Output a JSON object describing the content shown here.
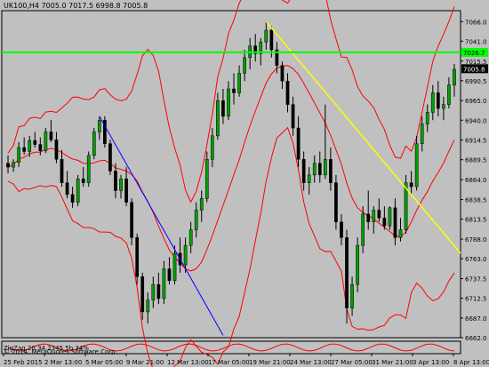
{
  "header": {
    "title": "UK100,H4  7005.0 7017.5 6998.8 7005.8"
  },
  "sub_window": {
    "label": "ZigZag 20 34.2345 5b 34%"
  },
  "copyright": "© 2014, MetaQuotes Software Corp.",
  "price_labels": {
    "horizontal_line": "7026.7",
    "current_price": "7005.8"
  },
  "colors": {
    "background": "#c0c0c0",
    "bull_candle": "#00a000",
    "bear_candle": "#000000",
    "bands": "#ff0000",
    "horizontal_line": "#00ff00",
    "trend_line_yellow": "#ffff00",
    "trend_line_blue": "#0000ff",
    "current_price_bg": "#000000",
    "horizontal_label_bg": "#00ff00"
  },
  "chart_data": {
    "type": "candlestick",
    "symbol": "UK100",
    "timeframe": "H4",
    "ylim": [
      6662,
      7080
    ],
    "y_ticks": [
      "7066.0",
      "7041.0",
      "7015.5",
      "6990.5",
      "6965.0",
      "6940.0",
      "6914.5",
      "6889.5",
      "6864.0",
      "6838.5",
      "6813.5",
      "6788.0",
      "6763.0",
      "6737.5",
      "6712.5",
      "6687.0",
      "6662.0"
    ],
    "x_ticks": [
      "25 Feb 2015",
      "2 Mar 13:00",
      "5 Mar 05:00",
      "9 Mar 21:00",
      "12 Mar 13:00",
      "17 Mar 05:00",
      "19 Mar 21:00",
      "24 Mar 13:00",
      "27 Mar 05:00",
      "31 Mar 21:00",
      "3 Apr 13:00",
      "8 Apr 13:00"
    ],
    "horizontal_line_price": 7026.7,
    "current_price": 7005.8,
    "candles": [
      [
        6885,
        6895,
        6872,
        6880
      ],
      [
        6880,
        6890,
        6874,
        6886
      ],
      [
        6886,
        6912,
        6880,
        6905
      ],
      [
        6905,
        6918,
        6896,
        6900
      ],
      [
        6900,
        6920,
        6893,
        6914
      ],
      [
        6914,
        6925,
        6905,
        6909
      ],
      [
        6909,
        6918,
        6895,
        6901
      ],
      [
        6901,
        6930,
        6898,
        6925
      ],
      [
        6925,
        6940,
        6912,
        6915
      ],
      [
        6915,
        6925,
        6885,
        6890
      ],
      [
        6890,
        6902,
        6855,
        6860
      ],
      [
        6860,
        6875,
        6840,
        6845
      ],
      [
        6845,
        6855,
        6828,
        6835
      ],
      [
        6835,
        6870,
        6830,
        6865
      ],
      [
        6865,
        6880,
        6855,
        6860
      ],
      [
        6860,
        6900,
        6855,
        6895
      ],
      [
        6895,
        6930,
        6890,
        6925
      ],
      [
        6925,
        6945,
        6915,
        6940
      ],
      [
        6940,
        6945,
        6905,
        6910
      ],
      [
        6910,
        6915,
        6870,
        6875
      ],
      [
        6875,
        6885,
        6840,
        6850
      ],
      [
        6850,
        6870,
        6840,
        6865
      ],
      [
        6865,
        6880,
        6830,
        6835
      ],
      [
        6835,
        6840,
        6780,
        6790
      ],
      [
        6790,
        6795,
        6730,
        6740
      ],
      [
        6740,
        6745,
        6685,
        6695
      ],
      [
        6695,
        6720,
        6680,
        6710
      ],
      [
        6710,
        6740,
        6700,
        6730
      ],
      [
        6730,
        6745,
        6705,
        6712
      ],
      [
        6712,
        6760,
        6705,
        6750
      ],
      [
        6750,
        6765,
        6730,
        6735
      ],
      [
        6735,
        6780,
        6730,
        6770
      ],
      [
        6770,
        6790,
        6745,
        6755
      ],
      [
        6755,
        6790,
        6745,
        6780
      ],
      [
        6780,
        6810,
        6770,
        6800
      ],
      [
        6800,
        6835,
        6790,
        6825
      ],
      [
        6825,
        6850,
        6810,
        6840
      ],
      [
        6840,
        6900,
        6835,
        6890
      ],
      [
        6890,
        6930,
        6880,
        6920
      ],
      [
        6920,
        6975,
        6915,
        6965
      ],
      [
        6965,
        6980,
        6935,
        6945
      ],
      [
        6945,
        6990,
        6940,
        6980
      ],
      [
        6980,
        7000,
        6960,
        6975
      ],
      [
        6975,
        7010,
        6970,
        7000
      ],
      [
        7000,
        7030,
        6990,
        7020
      ],
      [
        7020,
        7045,
        7005,
        7035
      ],
      [
        7035,
        7050,
        7015,
        7025
      ],
      [
        7025,
        7045,
        7010,
        7040
      ],
      [
        7040,
        7066,
        7030,
        7055
      ],
      [
        7055,
        7060,
        7020,
        7030
      ],
      [
        7030,
        7040,
        7000,
        7010
      ],
      [
        7010,
        7015,
        6980,
        6990
      ],
      [
        6990,
        7000,
        6950,
        6960
      ],
      [
        6960,
        6970,
        6920,
        6930
      ],
      [
        6930,
        6945,
        6880,
        6890
      ],
      [
        6890,
        6900,
        6850,
        6860
      ],
      [
        6860,
        6880,
        6845,
        6870
      ],
      [
        6870,
        6895,
        6860,
        6885
      ],
      [
        6885,
        6900,
        6860,
        6870
      ],
      [
        6870,
        6960,
        6865,
        6890
      ],
      [
        6890,
        6905,
        6850,
        6860
      ],
      [
        6860,
        6870,
        6800,
        6810
      ],
      [
        6810,
        6820,
        6780,
        6790
      ],
      [
        6790,
        6800,
        6680,
        6700
      ],
      [
        6700,
        6740,
        6690,
        6730
      ],
      [
        6730,
        6790,
        6720,
        6780
      ],
      [
        6780,
        6830,
        6770,
        6820
      ],
      [
        6820,
        6850,
        6800,
        6810
      ],
      [
        6810,
        6830,
        6795,
        6825
      ],
      [
        6825,
        6840,
        6810,
        6815
      ],
      [
        6815,
        6830,
        6800,
        6805
      ],
      [
        6805,
        6830,
        6800,
        6828
      ],
      [
        6828,
        6840,
        6780,
        6790
      ],
      [
        6790,
        6815,
        6785,
        6800
      ],
      [
        6800,
        6870,
        6795,
        6860
      ],
      [
        6860,
        6875,
        6845,
        6855
      ],
      [
        6855,
        6920,
        6850,
        6910
      ],
      [
        6910,
        6945,
        6900,
        6935
      ],
      [
        6935,
        6960,
        6925,
        6950
      ],
      [
        6950,
        6985,
        6940,
        6975
      ],
      [
        6975,
        6990,
        6945,
        6955
      ],
      [
        6955,
        6970,
        6940,
        6960
      ],
      [
        6960,
        6995,
        6955,
        6985
      ],
      [
        6985,
        7012,
        6970,
        7005
      ]
    ]
  }
}
